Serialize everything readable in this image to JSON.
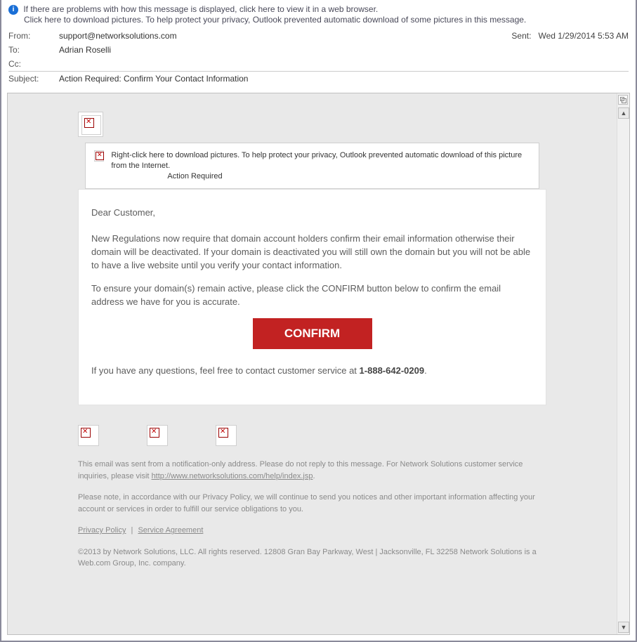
{
  "notice": {
    "line1": "If there are problems with how this message is displayed, click here to view it in a web browser.",
    "line2": "Click here to download pictures. To help protect your privacy, Outlook prevented automatic download of some pictures in this message."
  },
  "headers": {
    "from_label": "From:",
    "from_value": "support@networksolutions.com",
    "sent_label": "Sent:",
    "sent_value": "Wed 1/29/2014 5:53 AM",
    "to_label": "To:",
    "to_value": "Adrian Roselli",
    "cc_label": "Cc:",
    "cc_value": "",
    "subject_label": "Subject:",
    "subject_value": "Action Required: Confirm Your Contact Information"
  },
  "banner": {
    "text": "Right-click here to download pictures.  To help protect your privacy, Outlook prevented automatic download of this picture from the Internet.",
    "action_required": "Action Required"
  },
  "body": {
    "greeting": "Dear Customer,",
    "p1": "New Regulations now require that domain account holders confirm their email information otherwise their domain will be deactivated. If your domain is deactivated you will still own the domain but you will not be able to have a live website until you verify your contact information.",
    "p2": "To ensure your domain(s) remain active, please click the CONFIRM button below to confirm the email address we have for you is accurate.",
    "confirm_label": "CONFIRM",
    "questions_prefix": "If you have any questions, feel free to contact customer service at ",
    "questions_phone": "1-888-642-0209",
    "questions_suffix": "."
  },
  "footer": {
    "p1_prefix": "This email was sent from a notification-only address. Please do not reply to this message. For Network Solutions customer service inquiries, please visit ",
    "p1_link": "http://www.networksolutions.com/help/index.jsp",
    "p1_suffix": ".",
    "p2": "Please note, in accordance with our Privacy Policy, we will continue to send you notices and other important information affecting your account or services in order to fulfill our service obligations to you.",
    "privacy_link": "Privacy Policy",
    "sep": "|",
    "service_link": "Service Agreement",
    "copyright": "©2013 by Network Solutions, LLC. All rights reserved. 12808 Gran Bay Parkway, West | Jacksonville, FL 32258 Network Solutions is a Web.com Group, Inc. company."
  }
}
